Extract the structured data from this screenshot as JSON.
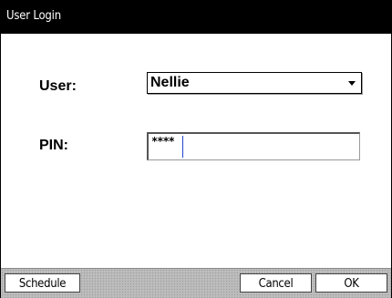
{
  "window": {
    "title": "User Login"
  },
  "form": {
    "user_label": "User:",
    "user_value": "Nellie",
    "pin_label": "PIN:",
    "pin_value": "****"
  },
  "buttons": {
    "schedule": "Schedule",
    "cancel": "Cancel",
    "ok": "OK"
  },
  "icons": {
    "user_select": "chevron-down-icon"
  },
  "colors": {
    "titlebar_bg": "#000000",
    "titlebar_text": "#ffffff",
    "caret": "#2244cc",
    "bottom_bar": "#bdbdbd"
  }
}
